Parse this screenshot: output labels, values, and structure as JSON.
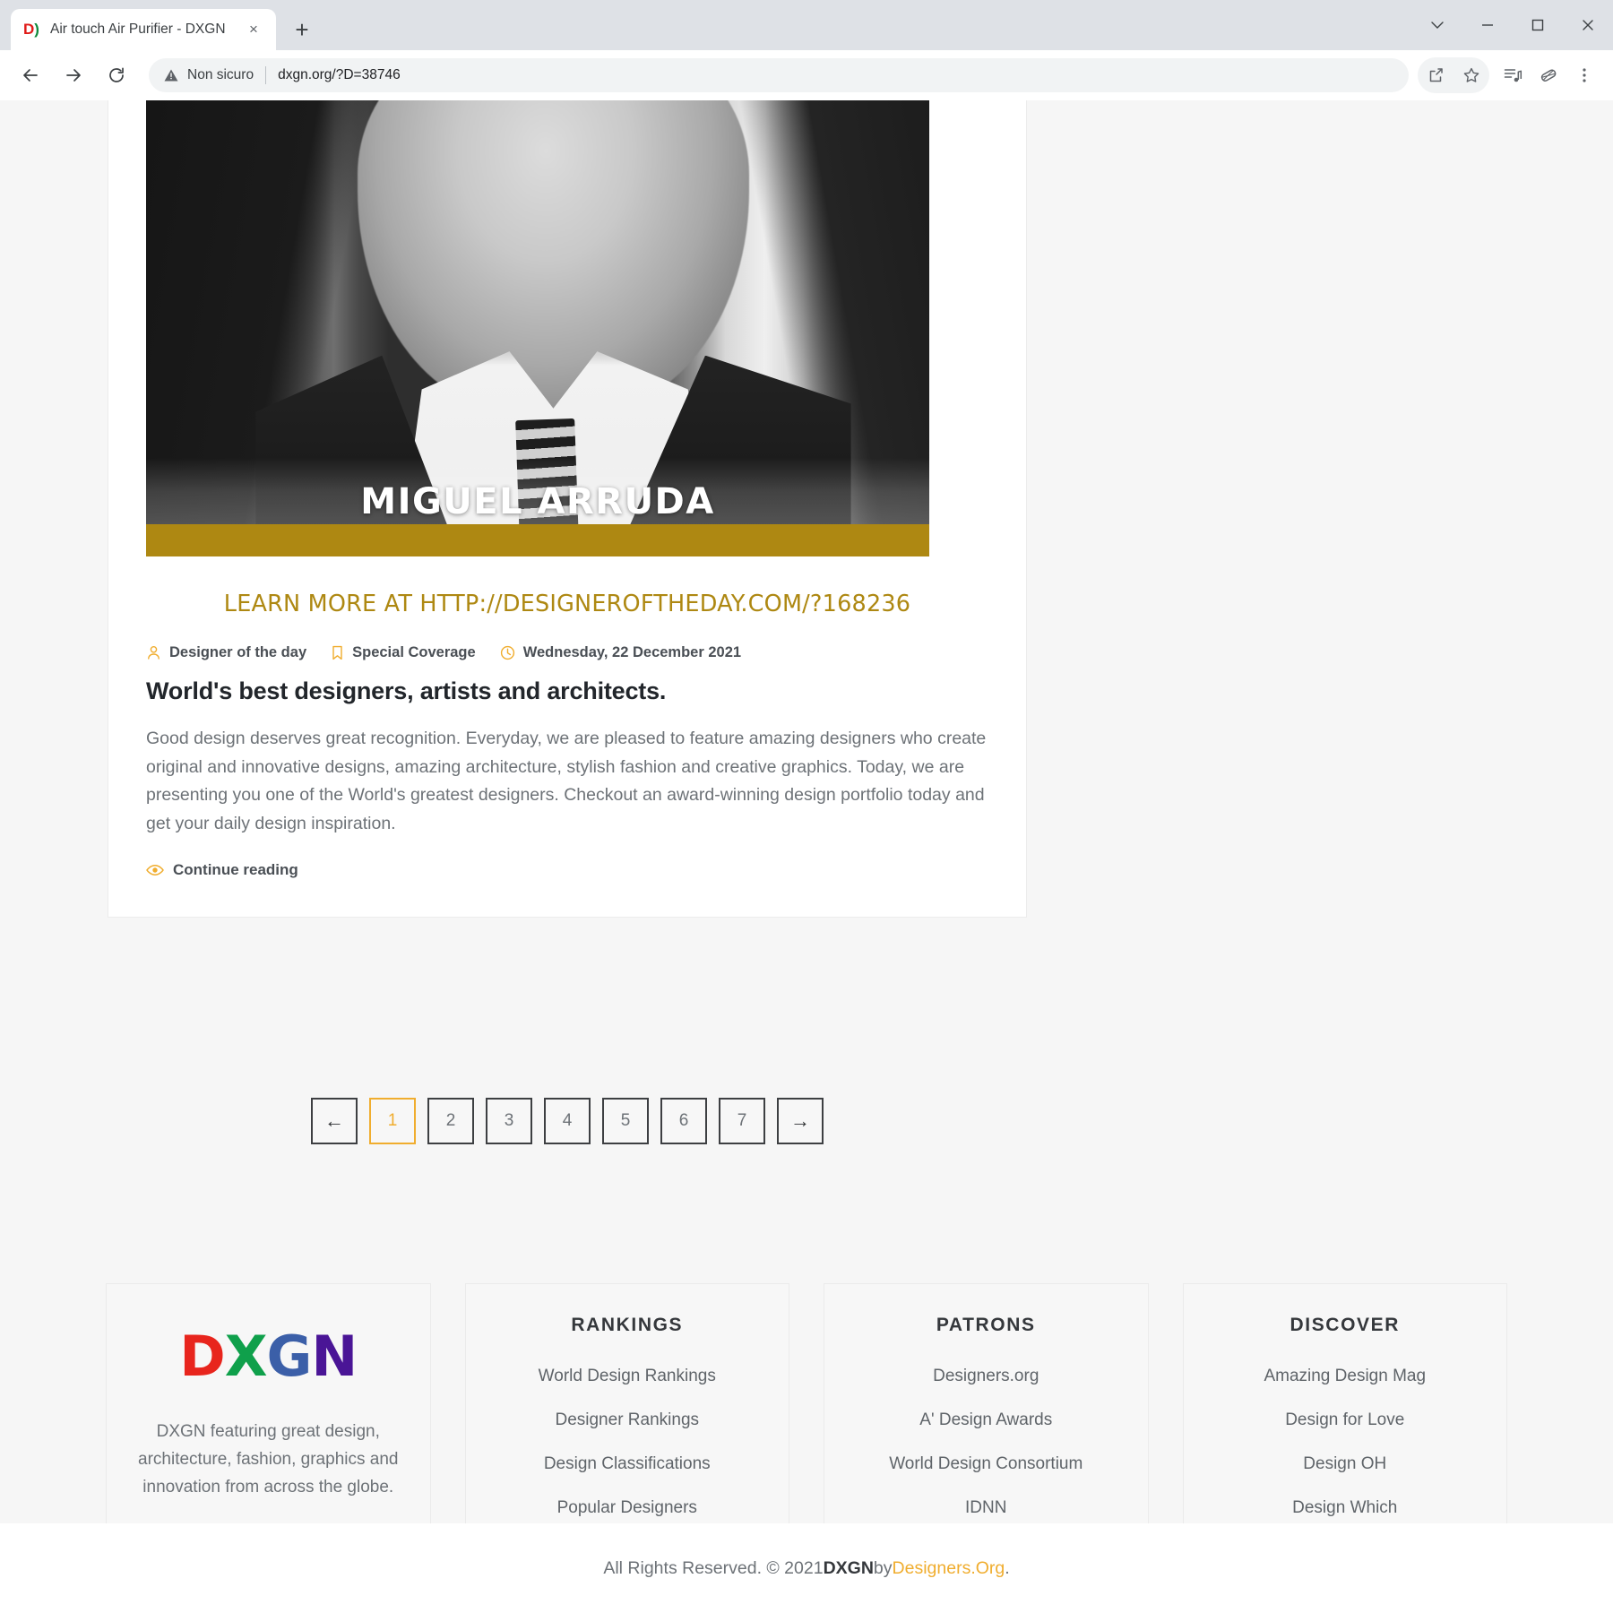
{
  "browser": {
    "tab": {
      "favicon_letter_1": "D",
      "favicon_letter_2": ")",
      "title": "Air touch Air Purifier - DXGN",
      "close_label": "×"
    },
    "new_tab_label": "+",
    "window_controls": {
      "expand_label": "⌄",
      "minimize_label": "–",
      "maximize_label": "□",
      "close_label": "✕"
    },
    "nav": {
      "back_label": "←",
      "forward_label": "→",
      "reload_label": "⟳"
    },
    "omnibox": {
      "security_text": "Non sicuro",
      "url": "dxgn.org/?D=38746"
    },
    "toolbar_icons": [
      {
        "name": "share-icon"
      },
      {
        "name": "bookmark-star-icon"
      },
      {
        "name": "reading-list-icon"
      },
      {
        "name": "extensions-icon"
      },
      {
        "name": "more-menu-icon"
      }
    ]
  },
  "article": {
    "hero": {
      "designer_name": "MIGUEL ARRUDA",
      "caption_link": "LEARN MORE AT HTTP://DESIGNEROFTHEDAY.COM/?168236",
      "accent_color": "#ae8812"
    },
    "meta": [
      {
        "icon": "user-icon",
        "label": "Designer of the day"
      },
      {
        "icon": "bookmark-icon",
        "label": "Special Coverage"
      },
      {
        "icon": "clock-icon",
        "label": "Wednesday, 22 December 2021"
      }
    ],
    "title": "World's best designers, artists and architects.",
    "body": "Good design deserves great recognition. Everyday, we are pleased to feature amazing designers who create original and innovative designs, amazing architecture, stylish fashion and creative graphics. Today, we are presenting you one of the World's greatest designers. Checkout an award-winning design portfolio today and get your daily design inspiration.",
    "continue_label": "Continue reading"
  },
  "pagination": {
    "prev_label": "←",
    "next_label": "→",
    "pages": [
      "1",
      "2",
      "3",
      "4",
      "5",
      "6",
      "7"
    ],
    "active_page": "1",
    "active_color": "#f0ad2e"
  },
  "footer": {
    "brand": {
      "logo": {
        "d": "D",
        "x": "X",
        "g": "G",
        "n": "N"
      },
      "description": "DXGN featuring great design, architecture, fashion, graphics and innovation from across the globe."
    },
    "columns": [
      {
        "title": "RANKINGS",
        "links": [
          "World Design Rankings",
          "Designer Rankings",
          "Design Classifications",
          "Popular Designers"
        ]
      },
      {
        "title": "PATRONS",
        "links": [
          "Designers.org",
          "A' Design Awards",
          "World Design Consortium",
          "IDNN"
        ]
      },
      {
        "title": "DISCOVER",
        "links": [
          "Amazing Design Mag",
          "Design for Love",
          "Design OH",
          "Design Which"
        ]
      }
    ],
    "copyright": {
      "prefix": "All Rights Reserved. © 2021 ",
      "brand": "DXGN",
      "middle": " by ",
      "partner": "Designers.Org",
      "suffix": "."
    }
  }
}
